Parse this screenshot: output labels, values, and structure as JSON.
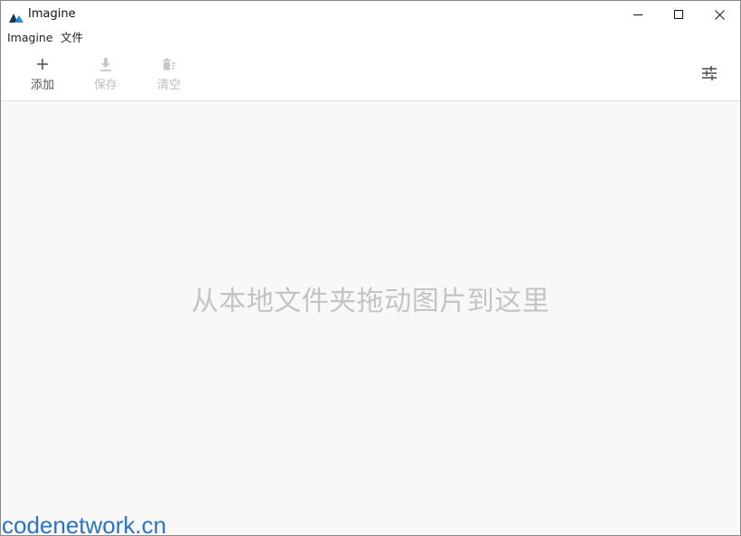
{
  "window": {
    "title": "Imagine",
    "icon": "mountain-icon",
    "controls": {
      "minimize": "minimize-icon",
      "maximize": "maximize-icon",
      "close": "close-icon"
    }
  },
  "menu": {
    "items": [
      {
        "label": "Imagine"
      },
      {
        "label": "文件"
      }
    ]
  },
  "toolbar": {
    "add_label": "添加",
    "save_label": "保存",
    "clear_label": "清空",
    "settings_icon": "sliders-icon"
  },
  "main": {
    "drop_hint": "从本地文件夹拖动图片到这里"
  },
  "watermark": {
    "text": "codenetwork.cn"
  },
  "colors": {
    "accent": "#2d8ad8",
    "disabled": "#bdbdbd",
    "drop_bg": "#f9f8f7",
    "watermark": "#2a74c4"
  }
}
